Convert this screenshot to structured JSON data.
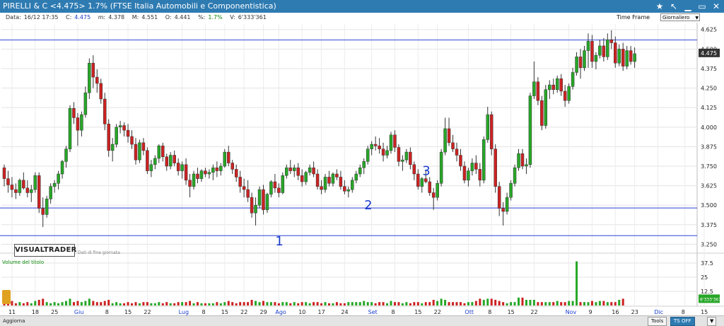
{
  "window": {
    "title": "PIRELLI & C <4.475> 1.7%  (FTSE Italia Automobili e Componentistica)"
  },
  "infobar": {
    "date_label": "Data:",
    "date_value": "16/12 17:35",
    "close_label": "C:",
    "close_value": "4.475",
    "min_label": "m:",
    "min_value": "4.378",
    "max_label": "M:",
    "max_value": "4.551",
    "open_label": "O:",
    "open_value": "4.441",
    "pct_label": "%:",
    "pct_value": "1.7%",
    "vol_label": "V:",
    "vol_value": "6'333'361"
  },
  "timeframe": {
    "label": "Time Frame",
    "selected": "Giornaliero"
  },
  "watermark": {
    "brand": "VISUALTRADER",
    "note": "Dati di fine giornata"
  },
  "volume_panel": {
    "label": "Volume del titolo",
    "last_value": "6'333'361"
  },
  "statusbar": {
    "aggiorna": "Aggiorna",
    "tools": "Tools",
    "ts": "TS OFF"
  },
  "colors": {
    "up": "#27a727",
    "down": "#cc2222",
    "line": "#5566dd",
    "annot": "#1a3ccc",
    "grid": "#e3e3e3"
  },
  "chart_data": {
    "type": "candlestick",
    "price_axis": {
      "ticks": [
        "4.625",
        "4.500",
        "4.375",
        "4.250",
        "4.125",
        "4.000",
        "3.875",
        "3.750",
        "3.625",
        "3.500",
        "3.375",
        "3.250"
      ],
      "ylim": [
        3.22,
        4.66
      ]
    },
    "last_price_label": "4.475",
    "volume_axis": {
      "ticks": [
        "37.5",
        "25",
        "12.5"
      ],
      "ylim": [
        0,
        40
      ],
      "unit": "M"
    },
    "date_labels": [
      {
        "label": "11",
        "i": 2
      },
      {
        "label": "18",
        "i": 8
      },
      {
        "label": "25",
        "i": 13
      },
      {
        "label": "Giu",
        "i": 19,
        "month": true
      },
      {
        "label": "8",
        "i": 27
      },
      {
        "label": "15",
        "i": 32
      },
      {
        "label": "22",
        "i": 37
      },
      {
        "label": "Lug",
        "i": 46,
        "month": true
      },
      {
        "label": "8",
        "i": 52
      },
      {
        "label": "15",
        "i": 57
      },
      {
        "label": "22",
        "i": 62
      },
      {
        "label": "29",
        "i": 67
      },
      {
        "label": "Ago",
        "i": 71,
        "month": true
      },
      {
        "label": "10",
        "i": 77
      },
      {
        "label": "17",
        "i": 82
      },
      {
        "label": "24",
        "i": 88
      },
      {
        "label": "Set",
        "i": 95,
        "month": true
      },
      {
        "label": "8",
        "i": 101
      },
      {
        "label": "15",
        "i": 107
      },
      {
        "label": "22",
        "i": 112
      },
      {
        "label": "Ott",
        "i": 120,
        "month": true
      },
      {
        "label": "8",
        "i": 126
      },
      {
        "label": "15",
        "i": 131
      },
      {
        "label": "22",
        "i": 137
      },
      {
        "label": "Nov",
        "i": 146,
        "month": true
      },
      {
        "label": "9",
        "i": 152
      },
      {
        "label": "16",
        "i": 158
      },
      {
        "label": "23",
        "i": 163
      },
      {
        "label": "Dic",
        "i": 169,
        "month": true
      },
      {
        "label": "8",
        "i": 176
      },
      {
        "label": "15",
        "i": 181
      }
    ],
    "horizontal_lines": [
      4.558,
      3.482,
      3.305
    ],
    "annotations": [
      {
        "text": "1",
        "i": 71,
        "price": 3.28
      },
      {
        "text": "2",
        "i": 94,
        "price": 3.51
      },
      {
        "text": "3",
        "i": 109,
        "price": 3.73
      }
    ],
    "ohlc": [
      [
        3.74,
        3.76,
        3.62,
        3.67
      ],
      [
        3.67,
        3.72,
        3.58,
        3.63
      ],
      [
        3.63,
        3.68,
        3.55,
        3.6
      ],
      [
        3.6,
        3.64,
        3.54,
        3.58
      ],
      [
        3.58,
        3.67,
        3.56,
        3.66
      ],
      [
        3.66,
        3.71,
        3.6,
        3.61
      ],
      [
        3.61,
        3.66,
        3.55,
        3.58
      ],
      [
        3.58,
        3.63,
        3.52,
        3.6
      ],
      [
        3.6,
        3.71,
        3.58,
        3.69
      ],
      [
        3.69,
        3.71,
        3.45,
        3.48
      ],
      [
        3.48,
        3.55,
        3.36,
        3.44
      ],
      [
        3.44,
        3.56,
        3.42,
        3.54
      ],
      [
        3.54,
        3.64,
        3.51,
        3.62
      ],
      [
        3.62,
        3.66,
        3.58,
        3.64
      ],
      [
        3.64,
        3.72,
        3.6,
        3.7
      ],
      [
        3.7,
        3.79,
        3.67,
        3.78
      ],
      [
        3.78,
        3.88,
        3.74,
        3.86
      ],
      [
        3.86,
        4.14,
        3.84,
        4.12
      ],
      [
        4.12,
        4.16,
        4.02,
        4.06
      ],
      [
        4.06,
        4.09,
        3.88,
        3.98
      ],
      [
        3.98,
        4.1,
        3.94,
        4.08
      ],
      [
        4.08,
        4.26,
        4.06,
        4.22
      ],
      [
        4.22,
        4.44,
        4.18,
        4.41
      ],
      [
        4.41,
        4.46,
        4.25,
        4.32
      ],
      [
        4.32,
        4.37,
        4.22,
        4.28
      ],
      [
        4.28,
        4.31,
        4.15,
        4.18
      ],
      [
        4.18,
        4.22,
        3.98,
        4.02
      ],
      [
        4.02,
        4.05,
        3.81,
        3.85
      ],
      [
        3.85,
        3.93,
        3.78,
        3.89
      ],
      [
        3.89,
        4.02,
        3.87,
        4.0
      ],
      [
        4.0,
        4.04,
        3.96,
        4.01
      ],
      [
        4.01,
        4.03,
        3.94,
        3.98
      ],
      [
        3.98,
        4.02,
        3.9,
        3.94
      ],
      [
        3.94,
        3.98,
        3.86,
        3.89
      ],
      [
        3.89,
        3.93,
        3.76,
        3.79
      ],
      [
        3.79,
        3.92,
        3.77,
        3.9
      ],
      [
        3.9,
        3.93,
        3.82,
        3.85
      ],
      [
        3.85,
        3.87,
        3.7,
        3.72
      ],
      [
        3.72,
        3.79,
        3.68,
        3.76
      ],
      [
        3.76,
        3.82,
        3.73,
        3.8
      ],
      [
        3.8,
        3.89,
        3.77,
        3.88
      ],
      [
        3.88,
        3.9,
        3.78,
        3.81
      ],
      [
        3.81,
        3.83,
        3.72,
        3.75
      ],
      [
        3.75,
        3.84,
        3.73,
        3.82
      ],
      [
        3.82,
        3.85,
        3.75,
        3.77
      ],
      [
        3.77,
        3.8,
        3.69,
        3.72
      ],
      [
        3.72,
        3.78,
        3.67,
        3.76
      ],
      [
        3.76,
        3.8,
        3.63,
        3.66
      ],
      [
        3.66,
        3.7,
        3.55,
        3.62
      ],
      [
        3.62,
        3.72,
        3.6,
        3.7
      ],
      [
        3.7,
        3.74,
        3.64,
        3.67
      ],
      [
        3.67,
        3.73,
        3.65,
        3.72
      ],
      [
        3.72,
        3.74,
        3.68,
        3.7
      ],
      [
        3.7,
        3.73,
        3.67,
        3.71
      ],
      [
        3.71,
        3.76,
        3.66,
        3.74
      ],
      [
        3.74,
        3.78,
        3.68,
        3.72
      ],
      [
        3.72,
        3.77,
        3.69,
        3.75
      ],
      [
        3.75,
        3.86,
        3.74,
        3.84
      ],
      [
        3.84,
        3.88,
        3.75,
        3.77
      ],
      [
        3.77,
        3.79,
        3.7,
        3.73
      ],
      [
        3.73,
        3.76,
        3.65,
        3.68
      ],
      [
        3.68,
        3.72,
        3.58,
        3.62
      ],
      [
        3.62,
        3.67,
        3.55,
        3.6
      ],
      [
        3.6,
        3.66,
        3.52,
        3.55
      ],
      [
        3.55,
        3.58,
        3.42,
        3.45
      ],
      [
        3.45,
        3.55,
        3.37,
        3.5
      ],
      [
        3.5,
        3.62,
        3.48,
        3.6
      ],
      [
        3.6,
        3.63,
        3.44,
        3.47
      ],
      [
        3.47,
        3.58,
        3.45,
        3.57
      ],
      [
        3.57,
        3.66,
        3.55,
        3.65
      ],
      [
        3.65,
        3.7,
        3.58,
        3.61
      ],
      [
        3.61,
        3.64,
        3.55,
        3.58
      ],
      [
        3.58,
        3.71,
        3.57,
        3.69
      ],
      [
        3.69,
        3.76,
        3.67,
        3.74
      ],
      [
        3.74,
        3.79,
        3.7,
        3.72
      ],
      [
        3.72,
        3.76,
        3.68,
        3.74
      ],
      [
        3.74,
        3.77,
        3.66,
        3.69
      ],
      [
        3.69,
        3.73,
        3.62,
        3.65
      ],
      [
        3.65,
        3.72,
        3.63,
        3.71
      ],
      [
        3.71,
        3.76,
        3.69,
        3.74
      ],
      [
        3.74,
        3.78,
        3.68,
        3.7
      ],
      [
        3.7,
        3.73,
        3.6,
        3.62
      ],
      [
        3.62,
        3.66,
        3.57,
        3.6
      ],
      [
        3.6,
        3.7,
        3.58,
        3.68
      ],
      [
        3.68,
        3.72,
        3.62,
        3.64
      ],
      [
        3.64,
        3.71,
        3.62,
        3.7
      ],
      [
        3.7,
        3.73,
        3.66,
        3.68
      ],
      [
        3.68,
        3.72,
        3.6,
        3.62
      ],
      [
        3.62,
        3.66,
        3.57,
        3.59
      ],
      [
        3.59,
        3.62,
        3.55,
        3.6
      ],
      [
        3.6,
        3.68,
        3.58,
        3.66
      ],
      [
        3.66,
        3.72,
        3.64,
        3.7
      ],
      [
        3.7,
        3.76,
        3.68,
        3.74
      ],
      [
        3.74,
        3.8,
        3.7,
        3.78
      ],
      [
        3.78,
        3.88,
        3.76,
        3.86
      ],
      [
        3.86,
        3.91,
        3.82,
        3.89
      ],
      [
        3.89,
        3.94,
        3.85,
        3.88
      ],
      [
        3.88,
        3.93,
        3.83,
        3.86
      ],
      [
        3.86,
        3.9,
        3.78,
        3.82
      ],
      [
        3.82,
        3.88,
        3.8,
        3.85
      ],
      [
        3.85,
        3.97,
        3.83,
        3.95
      ],
      [
        3.95,
        3.98,
        3.84,
        3.87
      ],
      [
        3.87,
        3.89,
        3.75,
        3.78
      ],
      [
        3.78,
        3.82,
        3.72,
        3.79
      ],
      [
        3.79,
        3.86,
        3.77,
        3.84
      ],
      [
        3.84,
        3.87,
        3.73,
        3.76
      ],
      [
        3.76,
        3.78,
        3.66,
        3.7
      ],
      [
        3.7,
        3.73,
        3.6,
        3.62
      ],
      [
        3.62,
        3.68,
        3.58,
        3.67
      ],
      [
        3.67,
        3.72,
        3.64,
        3.65
      ],
      [
        3.65,
        3.68,
        3.56,
        3.58
      ],
      [
        3.58,
        3.61,
        3.47,
        3.55
      ],
      [
        3.55,
        3.66,
        3.53,
        3.64
      ],
      [
        3.64,
        3.86,
        3.62,
        3.84
      ],
      [
        3.84,
        4.06,
        3.82,
        3.99
      ],
      [
        3.99,
        4.06,
        3.88,
        3.9
      ],
      [
        3.9,
        3.95,
        3.84,
        3.86
      ],
      [
        3.86,
        3.9,
        3.78,
        3.82
      ],
      [
        3.82,
        3.86,
        3.72,
        3.75
      ],
      [
        3.75,
        3.78,
        3.64,
        3.66
      ],
      [
        3.66,
        3.74,
        3.62,
        3.72
      ],
      [
        3.72,
        3.8,
        3.69,
        3.77
      ],
      [
        3.77,
        3.82,
        3.7,
        3.73
      ],
      [
        3.73,
        3.77,
        3.62,
        3.66
      ],
      [
        3.66,
        3.94,
        3.64,
        3.92
      ],
      [
        3.92,
        4.13,
        3.9,
        4.08
      ],
      [
        4.08,
        4.1,
        3.82,
        3.86
      ],
      [
        3.86,
        3.89,
        3.58,
        3.62
      ],
      [
        3.62,
        3.65,
        3.43,
        3.48
      ],
      [
        3.48,
        3.52,
        3.37,
        3.46
      ],
      [
        3.46,
        3.58,
        3.44,
        3.55
      ],
      [
        3.55,
        3.66,
        3.53,
        3.64
      ],
      [
        3.64,
        3.76,
        3.62,
        3.74
      ],
      [
        3.74,
        3.86,
        3.72,
        3.83
      ],
      [
        3.83,
        3.86,
        3.73,
        3.75
      ],
      [
        3.75,
        3.8,
        3.7,
        3.76
      ],
      [
        3.76,
        4.22,
        3.74,
        4.2
      ],
      [
        4.2,
        4.42,
        4.18,
        4.29
      ],
      [
        4.29,
        4.32,
        4.14,
        4.17
      ],
      [
        4.17,
        4.2,
        3.98,
        4.01
      ],
      [
        4.01,
        4.27,
        3.99,
        4.24
      ],
      [
        4.24,
        4.3,
        4.18,
        4.27
      ],
      [
        4.27,
        4.31,
        4.21,
        4.24
      ],
      [
        4.24,
        4.33,
        4.22,
        4.31
      ],
      [
        4.31,
        4.34,
        4.2,
        4.23
      ],
      [
        4.23,
        4.27,
        4.13,
        4.17
      ],
      [
        4.17,
        4.28,
        4.15,
        4.26
      ],
      [
        4.26,
        4.38,
        4.24,
        4.35
      ],
      [
        4.35,
        4.48,
        4.33,
        4.45
      ],
      [
        4.45,
        4.5,
        4.31,
        4.38
      ],
      [
        4.38,
        4.52,
        4.36,
        4.49
      ],
      [
        4.49,
        4.6,
        4.38,
        4.55
      ],
      [
        4.55,
        4.59,
        4.38,
        4.42
      ],
      [
        4.42,
        4.48,
        4.37,
        4.46
      ],
      [
        4.46,
        4.56,
        4.44,
        4.52
      ],
      [
        4.52,
        4.57,
        4.42,
        4.45
      ],
      [
        4.45,
        4.6,
        4.43,
        4.56
      ],
      [
        4.56,
        4.62,
        4.5,
        4.54
      ],
      [
        4.54,
        4.58,
        4.38,
        4.41
      ],
      [
        4.41,
        4.53,
        4.39,
        4.5
      ],
      [
        4.5,
        4.54,
        4.36,
        4.39
      ],
      [
        4.39,
        4.52,
        4.37,
        4.49
      ],
      [
        4.49,
        4.52,
        4.4,
        4.42
      ],
      [
        4.42,
        4.51,
        4.38,
        4.47
      ]
    ],
    "volume": [
      3,
      2,
      4,
      2,
      3,
      2,
      3,
      2,
      4,
      5,
      6,
      3,
      2,
      3,
      2,
      3,
      4,
      6,
      3,
      4,
      3,
      4,
      6,
      4,
      3,
      3,
      4,
      5,
      2,
      3,
      2,
      2,
      3,
      2,
      3,
      2,
      3,
      3,
      2,
      2,
      3,
      2,
      3,
      2,
      2,
      3,
      3,
      3,
      4,
      2,
      3,
      2,
      2,
      2,
      2,
      3,
      2,
      3,
      4,
      3,
      2,
      3,
      3,
      3,
      5,
      4,
      3,
      4,
      3,
      3,
      3,
      2,
      3,
      3,
      2,
      3,
      2,
      3,
      3,
      2,
      3,
      3,
      2,
      3,
      2,
      2,
      3,
      2,
      2,
      3,
      3,
      3,
      3,
      4,
      3,
      3,
      2,
      3,
      3,
      2,
      4,
      3,
      3,
      2,
      3,
      2,
      3,
      3,
      2,
      3,
      3,
      5,
      4,
      6,
      5,
      3,
      3,
      3,
      3,
      2,
      3,
      3,
      4,
      6,
      5,
      6,
      6,
      5,
      4,
      3,
      2,
      3,
      3,
      7,
      7,
      5,
      5,
      5,
      3,
      3,
      3,
      3,
      3,
      4,
      3,
      3,
      4,
      4,
      39,
      3,
      3,
      3,
      4,
      3,
      4,
      4,
      3,
      3,
      3,
      5,
      6
    ]
  }
}
